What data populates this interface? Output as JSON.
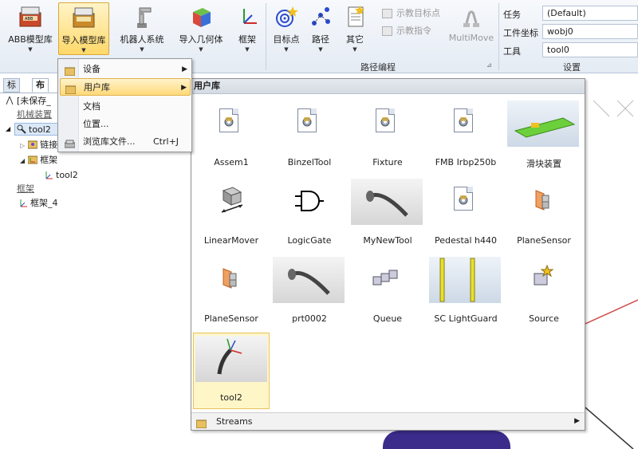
{
  "ribbon": {
    "buttons": {
      "abb_library": "ABB模型库",
      "import_library": "导入模型库",
      "robot_system": "机器人系统",
      "import_geometry": "导入几何体",
      "frame": "框架",
      "target": "目标点",
      "path": "路径",
      "other": "其它",
      "multimove": "MultiMove"
    },
    "small_commands": {
      "teach_target": "示教目标点",
      "teach_instruction": "示教指令"
    },
    "group_captions": {
      "path_programming": "路径编程",
      "settings": "设置"
    },
    "settings": {
      "task_label": "任务",
      "task_value": "(Default)",
      "workobject_label": "工件坐标",
      "workobject_value": "wobj0",
      "tool_label": "工具",
      "tool_value": "tool0"
    }
  },
  "left_pane": {
    "tabs": [
      "标记",
      "布局"
    ],
    "tree": {
      "station": "[未保存_",
      "mechanisms_header": "机械装置",
      "tool2": "tool2",
      "links": "链接",
      "frames_node": "框架",
      "frame_tool2": "tool2",
      "frames_header": "框架",
      "frame4": "框架_4"
    }
  },
  "menu": {
    "items": [
      {
        "label": "设备",
        "submenu": true
      },
      {
        "label": "用户库",
        "submenu": true
      },
      {
        "label": "文档",
        "submenu": false
      },
      {
        "label": "位置...",
        "submenu": false
      },
      {
        "label": "浏览库文件...",
        "shortcut": "Ctrl+J",
        "submenu": false
      }
    ]
  },
  "gallery": {
    "title": "用户库",
    "items": [
      {
        "label": "Assem1",
        "icon": "library-doc-icon"
      },
      {
        "label": "BinzelTool",
        "icon": "library-doc-icon"
      },
      {
        "label": "Fixture",
        "icon": "library-doc-icon"
      },
      {
        "label": "FMB Irbp250b",
        "icon": "library-doc-icon"
      },
      {
        "label": "滑块装置",
        "icon": "slider-device-thumbnail"
      },
      {
        "label": "LinearMover",
        "icon": "linear-mover-icon"
      },
      {
        "label": "LogicGate",
        "icon": "logic-gate-icon"
      },
      {
        "label": "MyNewTool",
        "icon": "tool-thumbnail"
      },
      {
        "label": "Pedestal h440",
        "icon": "library-doc-icon"
      },
      {
        "label": "PlaneSensor",
        "icon": "plane-sensor-icon"
      },
      {
        "label": "PlaneSensor",
        "icon": "plane-sensor-icon"
      },
      {
        "label": "prt0002",
        "icon": "tool-thumbnail"
      },
      {
        "label": "Queue",
        "icon": "queue-icon"
      },
      {
        "label": "SC LightGuard",
        "icon": "light-guard-thumbnail"
      },
      {
        "label": "Source",
        "icon": "source-icon"
      },
      {
        "label": "tool2",
        "icon": "tool2-thumbnail"
      }
    ],
    "footer": "Streams"
  },
  "colors": {
    "highlight": "#ffd978",
    "ribbon": "#e4ebf4",
    "selection": "#fff6c8"
  }
}
